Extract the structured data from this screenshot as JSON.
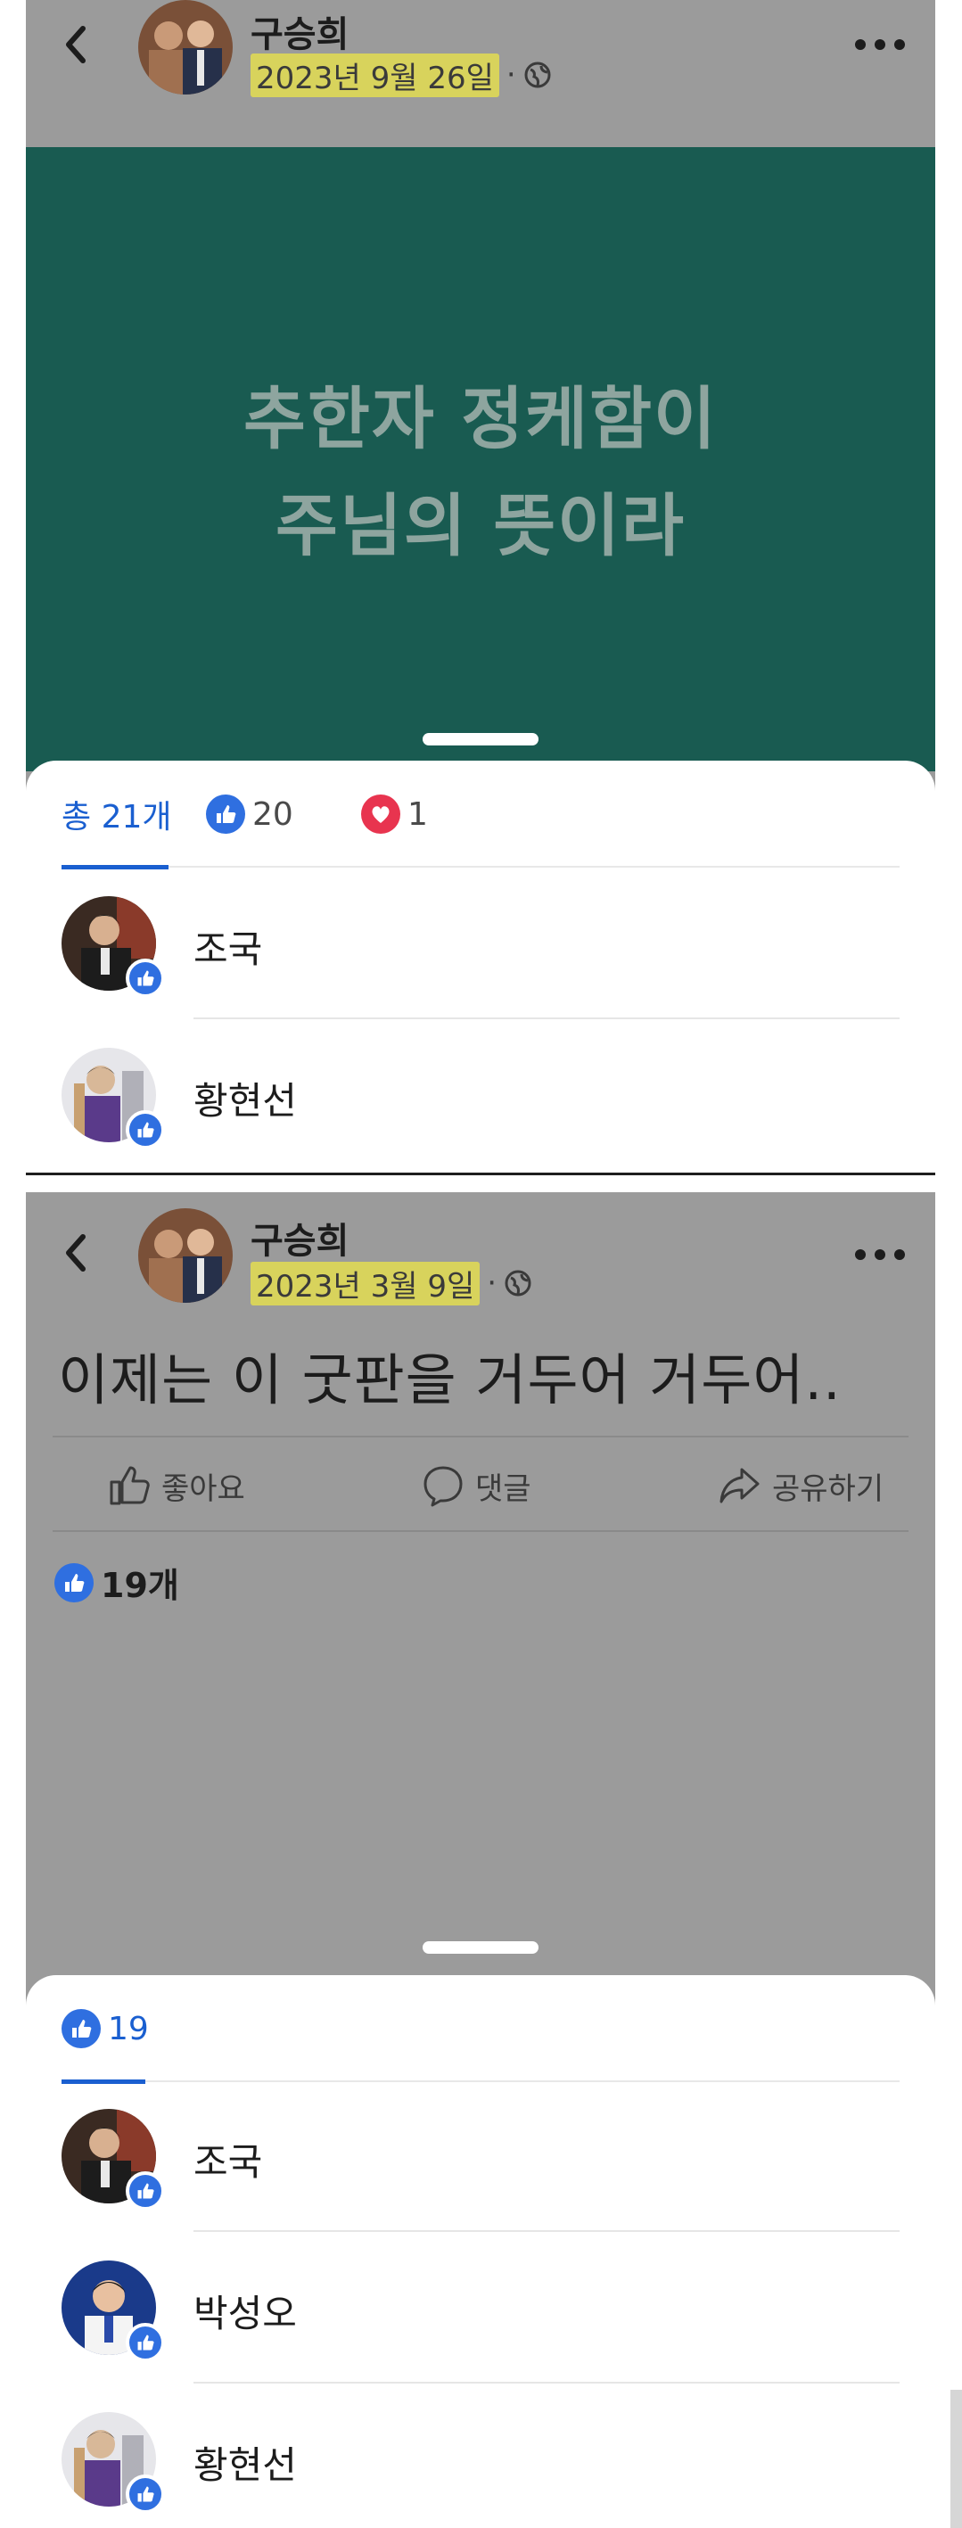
{
  "post1": {
    "author": "구승희",
    "date": "2023년 9월 26일",
    "separator": "·",
    "post_text_line1": "추한자 정케함이",
    "post_text_line2": "주님의 뜻이라",
    "reactions": {
      "total_label": "총 21개",
      "like_count": "20",
      "love_count": "1"
    },
    "reactors": [
      {
        "name": "조국"
      },
      {
        "name": "황현선"
      }
    ]
  },
  "post2": {
    "author": "구승희",
    "date": "2023년 3월 9일",
    "separator": "·",
    "post_text": "이제는 이 굿판을 거두어 거두어..",
    "actions": {
      "like": "좋아요",
      "comment": "댓글",
      "share": "공유하기"
    },
    "likes_summary": "19개",
    "reactions": {
      "like_count": "19"
    },
    "reactors": [
      {
        "name": "조국"
      },
      {
        "name": "박성오"
      },
      {
        "name": "황현선"
      }
    ]
  },
  "colors": {
    "post_bg": "#195b51",
    "overlay": "#9b9b9b",
    "accent": "#1a5fd0",
    "like": "#2f6fe0",
    "love": "#e8344f",
    "highlight": "#d8d35c"
  },
  "icons": [
    "back-chevron-icon",
    "globe-icon",
    "more-icon",
    "like-icon",
    "love-icon",
    "comment-icon",
    "share-icon"
  ]
}
